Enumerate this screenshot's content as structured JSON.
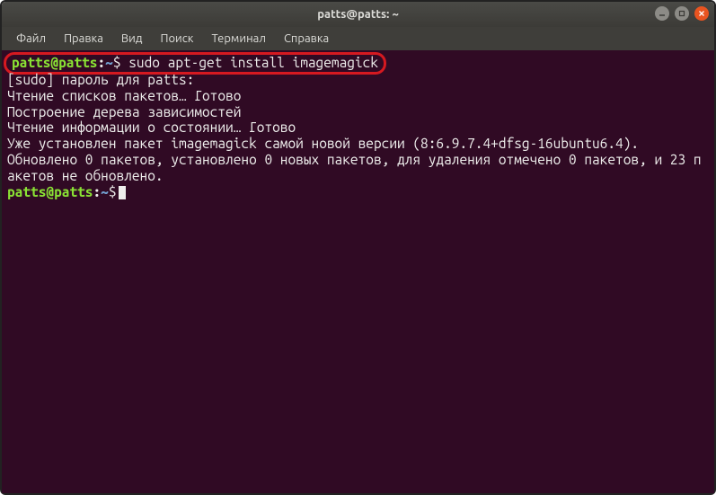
{
  "titlebar": {
    "title": "patts@patts: ~"
  },
  "menubar": {
    "items": [
      "Файл",
      "Правка",
      "Вид",
      "Поиск",
      "Терминал",
      "Справка"
    ]
  },
  "terminal": {
    "prompt1": {
      "userhost": "patts@patts",
      "colon": ":",
      "path": "~",
      "dollar": "$ ",
      "command": "sudo apt-get install imagemagick"
    },
    "lines": [
      "[sudo] пароль для patts:",
      "Чтение списков пакетов… Готово",
      "Построение дерева зависимостей",
      "Чтение информации о состоянии… Готово",
      "Уже установлен пакет imagemagick самой новой версии (8:6.9.7.4+dfsg-16ubuntu6.4).",
      "Обновлено 0 пакетов, установлено 0 новых пакетов, для удаления отмечено 0 пакетов, и 23 пакетов не обновлено."
    ],
    "prompt2": {
      "userhost": "patts@patts",
      "colon": ":",
      "path": "~",
      "dollar": "$"
    }
  }
}
